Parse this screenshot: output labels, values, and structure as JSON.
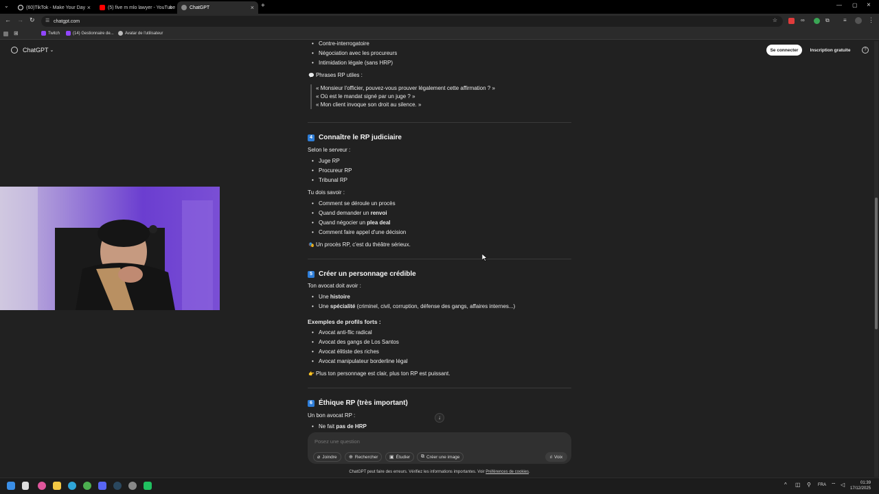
{
  "browser": {
    "tabs": [
      {
        "title": "(60)TikTok - Make Your Day"
      },
      {
        "title": "(5) five m mlo lawyer - YouTube"
      },
      {
        "title": "ChatGPT"
      }
    ],
    "url": "chatgpt.com",
    "bookmarks": [
      "Twitch",
      "(14) Gestionnaire de...",
      "Avatar de l'utilisateur"
    ]
  },
  "app": {
    "brand": "ChatGPT",
    "login_label": "Se connecter",
    "signup_label": "Inscription gratuite"
  },
  "content": {
    "top_bullets": [
      "Contre-interrogatoire",
      "Négociation avec les procureurs",
      "Intimidation légale (sans HRP)"
    ],
    "phrases_title": "Phrases RP utiles :",
    "quotes": [
      "« Monsieur l'officier, pouvez-vous prouver légalement cette affirmation ? »",
      "« Où est le mandat signé par un juge ? »",
      "« Mon client invoque son droit au silence. »"
    ],
    "s4": {
      "num": "4",
      "title": "Connaître le RP judiciaire",
      "intro": "Selon le serveur :",
      "roles": [
        "Juge RP",
        "Procureur RP",
        "Tribunal RP"
      ],
      "must_know": "Tu dois savoir :",
      "items": {
        "a": "Comment se déroule un procès",
        "b_pre": "Quand demander un ",
        "b_bold": "renvoi",
        "c_pre": "Quand négocier un ",
        "c_bold": "plea deal",
        "d": "Comment faire appel d'une décision"
      },
      "note": "Un procès RP, c'est du théâtre sérieux."
    },
    "s5": {
      "num": "5",
      "title": "Créer un personnage crédible",
      "intro": "Ton avocat doit avoir :",
      "item1_pre": "Une ",
      "item1_bold": "histoire",
      "item2_pre": "Une ",
      "item2_bold": "spécialité",
      "item2_post": " (criminel, civil, corruption, défense des gangs, affaires internes...)",
      "profiles_title": "Exemples de profils forts :",
      "profiles": [
        "Avocat anti-flic radical",
        "Avocat des gangs de Los Santos",
        "Avocat élitiste des riches",
        "Avocat manipulateur borderline légal"
      ],
      "note": "Plus ton personnage est clair, plus ton RP est puissant."
    },
    "s6": {
      "num": "6",
      "title": "Éthique RP (très important)",
      "intro": "Un bon avocat RP :",
      "item1_pre": "Ne fait ",
      "item1_bold": "pas de HRP"
    }
  },
  "composer": {
    "placeholder": "Posez une question",
    "buttons": [
      "Joindre",
      "Rechercher",
      "Étudier",
      "Créer une image"
    ],
    "voice_label": "Voix"
  },
  "footer": {
    "disclaimer": "ChatGPT peut faire des erreurs. Vérifiez les informations importantes. Voir ",
    "link": "Préférences de cookies",
    "end": "."
  },
  "taskbar": {
    "lang": "FRA",
    "time": "01:39",
    "date": "17/12/2025"
  },
  "colors": {
    "background": "#212121",
    "accent_number": "#2e7dd7",
    "webcam_bg": "#7a4fd5"
  }
}
